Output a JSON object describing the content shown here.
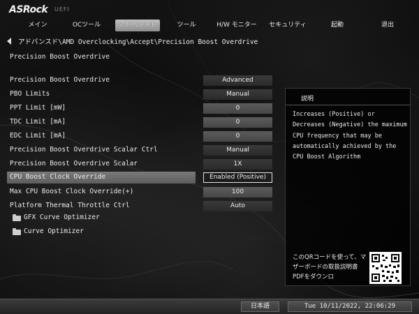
{
  "brand": {
    "logo": "ASRock",
    "sub": "UEFI"
  },
  "tabs": [
    {
      "label": "メイン",
      "active": false
    },
    {
      "label": "OCツール",
      "active": false
    },
    {
      "label": "アドバンスド",
      "active": true
    },
    {
      "label": "ツール",
      "active": false
    },
    {
      "label": "H/W モニター",
      "active": false
    },
    {
      "label": "セキュリティ",
      "active": false
    },
    {
      "label": "起動",
      "active": false
    },
    {
      "label": "退出",
      "active": false
    }
  ],
  "breadcrumb": "アドバンスド\\AMD Overclocking\\Accept\\Precision Boost Overdrive",
  "section_title": "Precision Boost Overdrive",
  "settings": [
    {
      "label": "Precision Boost Overdrive",
      "value": "Advanced",
      "kind": "select"
    },
    {
      "label": "PBO Limits",
      "value": "Manual",
      "kind": "select"
    },
    {
      "label": "PPT Limit [mW]",
      "value": "0",
      "kind": "input"
    },
    {
      "label": "TDC Limit [mA]",
      "value": "0",
      "kind": "input"
    },
    {
      "label": "EDC Limit [mA]",
      "value": "0",
      "kind": "input"
    },
    {
      "label": "Precision Boost Overdrive Scalar Ctrl",
      "value": "Manual",
      "kind": "select"
    },
    {
      "label": "Precision Boost Overdrive Scalar",
      "value": "1X",
      "kind": "select"
    },
    {
      "label": "CPU Boost Clock Override",
      "value": "Enabled (Positive)",
      "kind": "select",
      "selected": true
    },
    {
      "label": "Max CPU Boost Clock Override(+)",
      "value": "100",
      "kind": "input"
    },
    {
      "label": "Platform Thermal Throttle Ctrl",
      "value": "Auto",
      "kind": "select"
    }
  ],
  "submenus": [
    {
      "label": "GFX Curve Optimizer",
      "icon": "folder-icon"
    },
    {
      "label": "Curve Optimizer",
      "icon": "folder-icon"
    }
  ],
  "description": {
    "title": "説明",
    "body": "Increases (Positive) or Decreases (Negative) the maximum CPU frequency that may be automatically achieved by the CPU Boost Algorithm",
    "qr_text": "このQRコードを使って、マザーボードの取扱説明書PDFをダウンロ"
  },
  "bottom": {
    "language": "日本語",
    "datetime": "Tue 10/11/2022, 22:06:29"
  },
  "colors": {
    "highlight": "#6b6b6b",
    "active_tab": "#a8a8a8",
    "background": "#0a0a0a"
  }
}
